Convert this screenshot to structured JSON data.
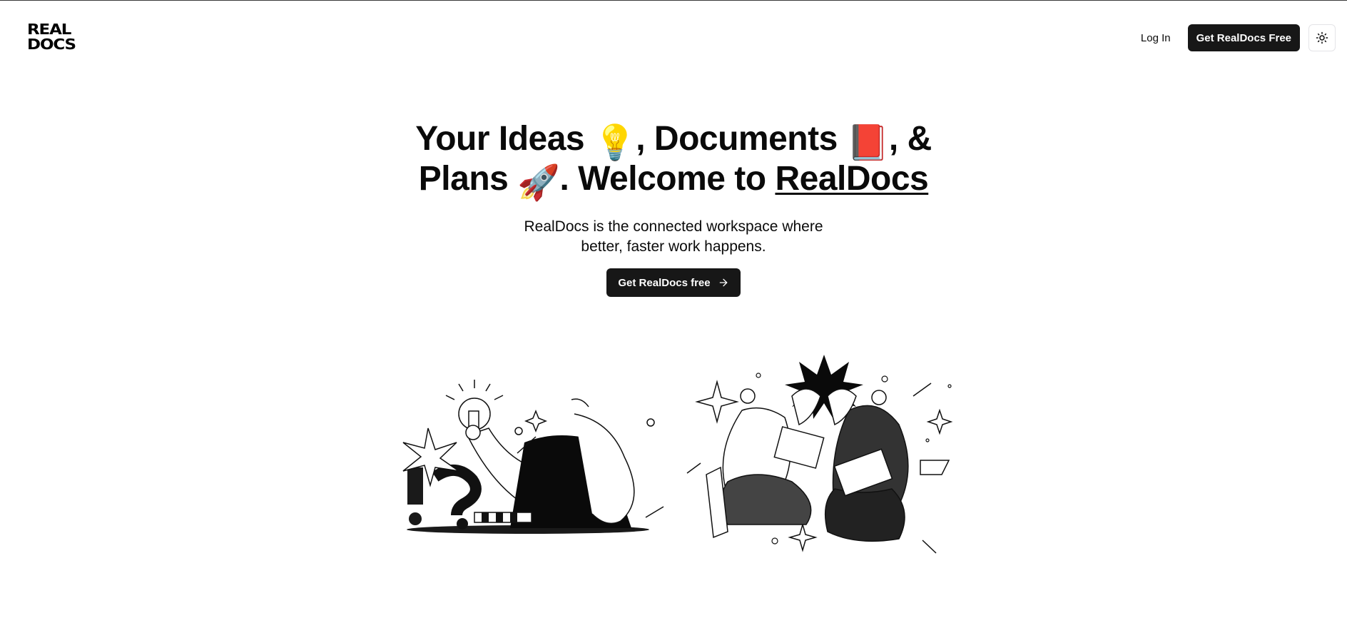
{
  "brand": {
    "logo_line1": "REAL",
    "logo_line2": "DOCS"
  },
  "nav": {
    "login_label": "Log In",
    "cta_label": "Get RealDocs Free",
    "theme_icon": "sun-icon"
  },
  "hero": {
    "title_part1": "Your Ideas",
    "title_emoji1": "💡",
    "title_part2": ", Documents",
    "title_emoji2": "📕",
    "title_part3": ", & Plans",
    "title_emoji3": "🚀",
    "title_part4": ". Welcome to",
    "title_brand": "RealDocs",
    "subtitle": "RealDocs is the connected workspace where better, faster work happens.",
    "cta_label": "Get RealDocs free",
    "cta_icon": "arrow-right-icon"
  },
  "illustrations": {
    "left": "thinking-person-illustration",
    "right": "high-five-illustration"
  },
  "colors": {
    "primary": "#171717",
    "text": "#0a0a0a",
    "background": "#ffffff"
  }
}
